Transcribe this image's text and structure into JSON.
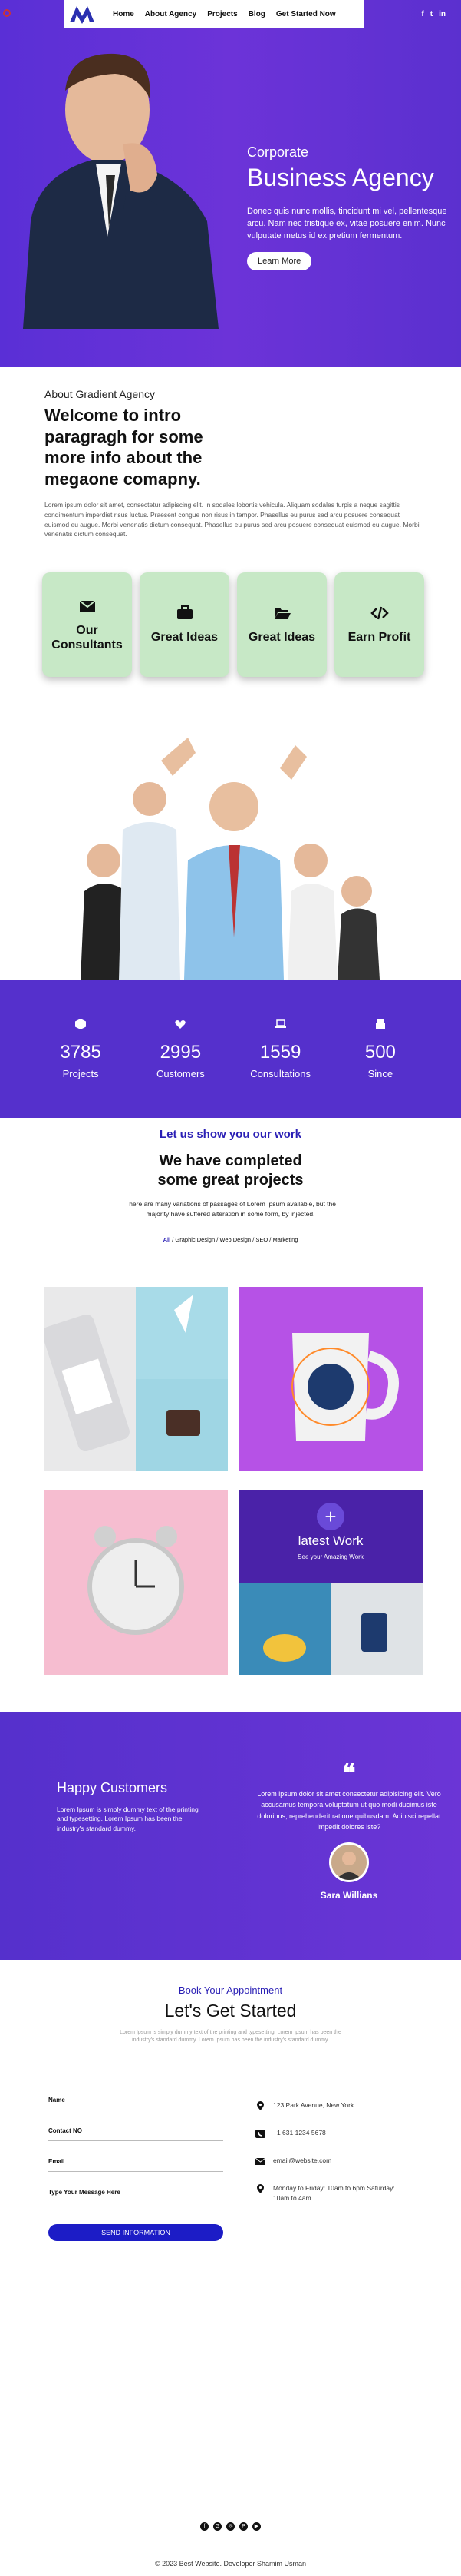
{
  "nav": {
    "links": [
      "Home",
      "About Agency",
      "Projects",
      "Blog"
    ],
    "cta": "Get Started Now",
    "social": [
      "f",
      "t",
      "in"
    ]
  },
  "hero": {
    "subtitle": "Corporate",
    "title": "Business Agency",
    "description": "Donec quis nunc mollis, tincidunt mi vel, pellentesque arcu. Nam nec tristique ex, vitae posuere enim. Nunc vulputate metus id ex pretium fermentum.",
    "button": "Learn More"
  },
  "about": {
    "kicker": "About Gradient Agency",
    "title": "Welcome to intro paragragh for some more info about the megaone comapny.",
    "body": "Lorem ipsum dolor sit amet, consectetur adipiscing elit. In sodales lobortis vehicula. Aliquam sodales turpis a neque sagittis condimentum imperdiet risus luctus. Praesent congue non risus in tempor. Phasellus eu purus sed arcu posuere consequat euismod eu augue. Morbi venenatis dictum consequat. Phasellus eu purus sed arcu posuere consequat euismod eu augue. Morbi venenatis dictum consequat."
  },
  "features": [
    {
      "label": "Our Consultants",
      "icon": "envelope-icon"
    },
    {
      "label": "Great Ideas",
      "icon": "briefcase-icon"
    },
    {
      "label": "Great Ideas",
      "icon": "folder-open-icon"
    },
    {
      "label": "Earn Profit",
      "icon": "code-icon"
    }
  ],
  "stats": [
    {
      "value": "3785",
      "label": "Projects",
      "icon": "cube-icon"
    },
    {
      "value": "2995",
      "label": "Customers",
      "icon": "heart-icon"
    },
    {
      "value": "1559",
      "label": "Consultations",
      "icon": "laptop-icon"
    },
    {
      "value": "500",
      "label": "Since",
      "icon": "box-icon"
    }
  ],
  "work": {
    "kicker": "Let us show you our work",
    "title": "We have completed some great projects",
    "description": "There are many variations of passages of Lorem Ipsum available, but the majority have suffered alteration in some form, by injected.",
    "filters": [
      "All",
      "Graphic Design",
      "Web Design",
      "SEO",
      "Marketing"
    ],
    "overlay_title": "latest Work",
    "overlay_sub": "See your Amazing Work",
    "plus": "+"
  },
  "testimonial": {
    "heading": "Happy Customers",
    "text": "Lorem Ipsum is simply dummy text of the printing and typesetting. Lorem Ipsum has been the industry's standard dummy.",
    "quote_mark": "❝",
    "quote": "Lorem ipsum dolor sit amet consectetur adipisicing elit. Vero accusamus tempora voluptatum ut quo modi ducimus iste doloribus, reprehenderit ratione quibusdam. Adipisci repellat impedit dolores iste?",
    "name": "Sara Willians"
  },
  "contact": {
    "kicker": "Book Your Appointment",
    "title": "Let's Get Started",
    "description": "Lorem Ipsum is simply dummy text of the printing and typesetting. Lorem Ipsum has been the industry's standard dummy. Lorem Ipsum has been the industry's standard dummy.",
    "fields": [
      "Name",
      "Contact NO",
      "Email",
      "Type Your Message Here"
    ],
    "button": "SEND INFORMATION",
    "info": [
      {
        "icon": "location-icon",
        "text": "123 Park Avenue, New York"
      },
      {
        "icon": "phone-icon",
        "text": "+1 631 1234 5678"
      },
      {
        "icon": "mail-icon",
        "text": "email@website.com"
      },
      {
        "icon": "clock-icon",
        "text": "Monday to Friday: 10am to 6pm Saturday: 10am to 4am"
      }
    ]
  },
  "footer": {
    "icons": [
      "f",
      "G",
      "◎",
      "P",
      "▶"
    ],
    "copyright": "© 2023 Best Website. Developer Shamim Usman"
  }
}
